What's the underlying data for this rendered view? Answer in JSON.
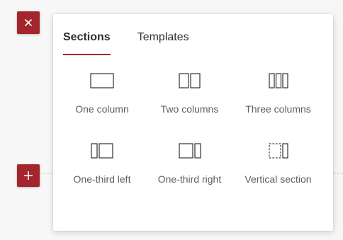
{
  "tabs": [
    {
      "label": "Sections",
      "active": true
    },
    {
      "label": "Templates",
      "active": false
    }
  ],
  "options": [
    {
      "label": "One column",
      "icon": "one-column-icon"
    },
    {
      "label": "Two columns",
      "icon": "two-columns-icon"
    },
    {
      "label": "Three columns",
      "icon": "three-columns-icon"
    },
    {
      "label": "One-third left",
      "icon": "one-third-left-icon"
    },
    {
      "label": "One-third right",
      "icon": "one-third-right-icon"
    },
    {
      "label": "Vertical section",
      "icon": "vertical-section-icon"
    }
  ],
  "buttons": {
    "close_icon": "close-icon",
    "add_icon": "plus-icon"
  },
  "colors": {
    "accent": "#a4262c",
    "label_text": "#605e5c",
    "tab_text": "#323130",
    "icon_stroke": "#323130"
  }
}
